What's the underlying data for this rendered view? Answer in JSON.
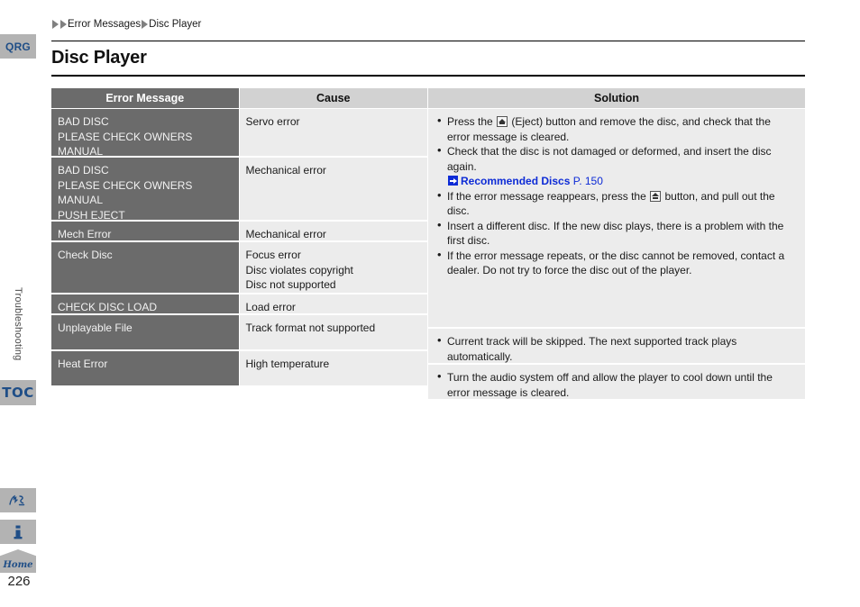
{
  "sidebar": {
    "qrg_label": "QRG",
    "toc_label": "TOC",
    "section_label": "Troubleshooting",
    "voice_icon": "voice-command-icon",
    "info_icon": "information-icon",
    "home_label": "Home",
    "page_number": "226"
  },
  "breadcrumb": {
    "item1": "Error Messages",
    "item2": "Disc Player"
  },
  "header": {
    "title": "Disc Player"
  },
  "table": {
    "columns": [
      "Error Message",
      "Cause",
      "Solution"
    ],
    "error_messages": [
      "BAD DISC\nPLEASE CHECK OWNERS\nMANUAL",
      "BAD DISC\nPLEASE CHECK OWNERS\nMANUAL\nPUSH EJECT",
      "Mech Error",
      "Check Disc",
      "CHECK DISC LOAD",
      "Unplayable File",
      "Heat Error"
    ],
    "causes": [
      "Servo error",
      "Mechanical error",
      "Mechanical error",
      "Focus error\nDisc violates copyright\nDisc not supported",
      "Load error",
      "Track format not supported",
      "High temperature"
    ],
    "solution_group1": {
      "bullets": [
        "Press the  (Eject) button and remove the disc, and check that the error message is cleared.",
        "Check that the disc is not damaged or deformed, and insert the disc again.",
        "If the error message reappears, press the  button, and pull out the disc.",
        "Insert a different disc. If the new disc plays, there is a problem with the first disc.",
        "If the error message repeats, or the disc cannot be removed, contact a dealer. Do not try to force the disc out of the player."
      ],
      "bullet1_pre": "Press the",
      "bullet1_post": "(Eject) button and remove the disc, and check that the error message is cleared.",
      "bullet2": "Check that the disc is not damaged or deformed, and insert the disc again.",
      "xref_title": "Recommended Discs",
      "xref_page": "P. 150",
      "bullet3_pre": "If the error message reappears, press the",
      "bullet3_post": "button, and pull out the disc.",
      "bullet4": "Insert a different disc. If the new disc plays, there is a problem with the first disc.",
      "bullet5": "If the error message repeats, or the disc cannot be removed, contact a dealer. Do not try to force the disc out of the player."
    },
    "solution_unplayable": "Current track will be skipped. The next supported track plays automatically.",
    "solution_heat": "Turn the audio system off and allow the player to cool down until the error message is cleared."
  },
  "colors": {
    "header_dark": "#6b6b6b",
    "header_light": "#d2d2d2",
    "cell_light": "#ececec",
    "accent_blue": "#1f4e87",
    "link_blue": "#0d2bd6",
    "tab_gray": "#b3b3b3"
  }
}
